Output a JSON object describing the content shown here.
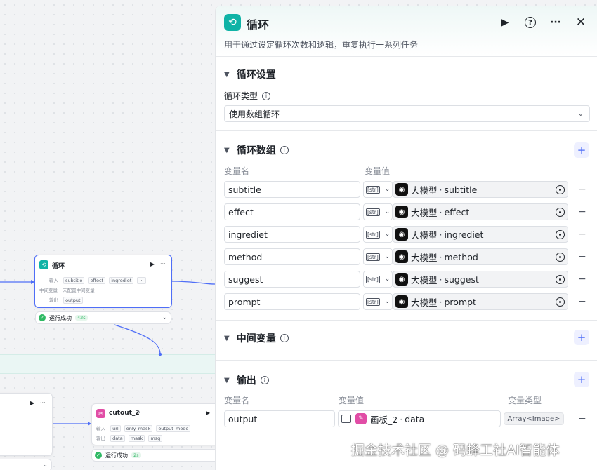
{
  "canvas": {
    "loop_node": {
      "title": "循环",
      "input_label": "输入",
      "inputs": [
        "subtitle",
        "effect",
        "ingrediet"
      ],
      "more": "···",
      "mid_label": "中间变量",
      "mid_value": "未配置中间变量",
      "output_label": "输出",
      "output": "output",
      "status": "运行成功",
      "time": "42s"
    },
    "cutout_node": {
      "title": "cutout_2",
      "input_label": "输入",
      "inputs": [
        "url",
        "only_mask",
        "output_mode"
      ],
      "output_label": "输出",
      "outputs": [
        "data",
        "mask",
        "msg"
      ],
      "status": "运行成功",
      "time": "2s"
    }
  },
  "panel": {
    "title": "循环",
    "description": "用于通过设定循环次数和逻辑，重复执行一系列任务",
    "loop_settings": {
      "title": "循环设置",
      "type_label": "循环类型",
      "type_value": "使用数组循环"
    },
    "loop_array": {
      "title": "循环数组",
      "name_header": "变量名",
      "value_header": "变量值",
      "type_tag": "[str]",
      "rows": [
        {
          "name": "subtitle",
          "source": "大模型",
          "field": "subtitle"
        },
        {
          "name": "effect",
          "source": "大模型",
          "field": "effect"
        },
        {
          "name": "ingrediet",
          "source": "大模型",
          "field": "ingrediet"
        },
        {
          "name": "method",
          "source": "大模型",
          "field": "method"
        },
        {
          "name": "suggest",
          "source": "大模型",
          "field": "suggest"
        },
        {
          "name": "prompt",
          "source": "大模型",
          "field": "prompt"
        }
      ]
    },
    "intermediate": {
      "title": "中间变量"
    },
    "output": {
      "title": "输出",
      "name_header": "变量名",
      "value_header": "变量值",
      "type_header": "变量类型",
      "name": "output",
      "source": "画板_2",
      "field": "data",
      "type": "Array<Image>"
    }
  },
  "watermark": "掘金技术社区 @ 码蜂工社AI智能体",
  "icons": {
    "loop": "loop-icon",
    "run": "play-icon",
    "help": "help-icon",
    "more": "more-icon",
    "close": "close-icon"
  },
  "colors": {
    "accent": "#4f6ef7",
    "loop_brand": "#10b3a6",
    "success": "#2fb964",
    "cutout_brand": "#e14da6"
  }
}
